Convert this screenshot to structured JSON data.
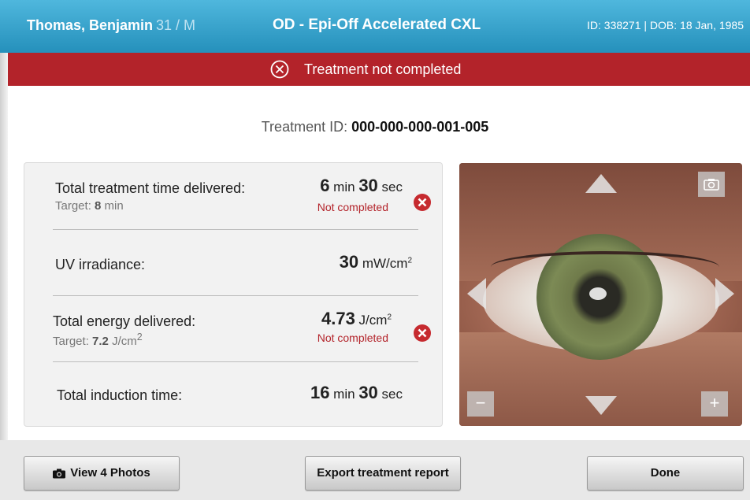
{
  "header": {
    "patient_name": "Thomas, Benjamin",
    "patient_age_sex": "31 / M",
    "eye": "OD",
    "protocol": "- Epi-Off Accelerated CXL",
    "ids": "ID: 338271 | DOB: 18 Jan, 1985"
  },
  "alert": {
    "text": "Treatment not completed",
    "color": "#b3232a"
  },
  "treatment": {
    "id_label": "Treatment ID:",
    "id_value": "000-000-000-001-005"
  },
  "results": {
    "time": {
      "label": "Total treatment time delivered:",
      "target_label": "Target:",
      "target_value": "8",
      "target_unit": "min",
      "value_min": "6",
      "unit_min": "min",
      "value_sec": "30",
      "unit_sec": "sec",
      "status": "Not completed"
    },
    "irradiance": {
      "label": "UV irradiance:",
      "value": "30",
      "unit": "mW/cm",
      "unit_exp": "2"
    },
    "energy": {
      "label": "Total energy delivered:",
      "target_label": "Target:",
      "target_value": "7.2",
      "target_unit": "J/cm",
      "target_exp": "2",
      "value": "4.73",
      "unit": "J/cm",
      "unit_exp": "2",
      "status": "Not completed"
    },
    "induction": {
      "label": "Total induction time:",
      "value_min": "16",
      "unit_min": "min",
      "value_sec": "30",
      "unit_sec": "sec"
    }
  },
  "image_controls": {
    "minus": "−",
    "plus": "+"
  },
  "footer": {
    "view_photos": "View 4 Photos",
    "export": "Export treatment report",
    "done": "Done"
  }
}
